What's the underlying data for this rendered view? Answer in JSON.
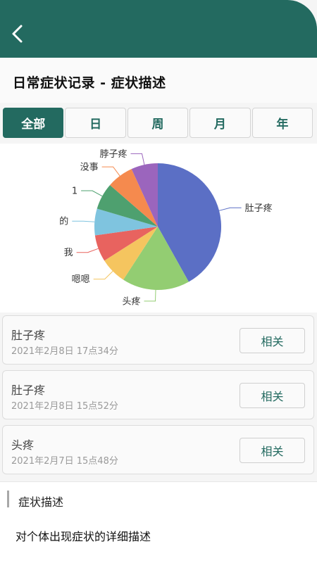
{
  "header": {
    "back_icon": "chevron-left-icon",
    "title": "日常症状记录 - 症状描述",
    "bar_color": "#236a60"
  },
  "tabs": [
    {
      "label": "全部",
      "active": true
    },
    {
      "label": "日",
      "active": false
    },
    {
      "label": "周",
      "active": false
    },
    {
      "label": "月",
      "active": false
    },
    {
      "label": "年",
      "active": false
    }
  ],
  "chart_data": {
    "type": "pie",
    "slices": [
      {
        "label": "肚子疼",
        "value": 8,
        "color": "#5b6fc5"
      },
      {
        "label": "头疼",
        "value": 3.3,
        "color": "#93cd72"
      },
      {
        "label": "嗯嗯",
        "value": 1.3,
        "color": "#f5c55f"
      },
      {
        "label": "我",
        "value": 1.3,
        "color": "#e8635f"
      },
      {
        "label": "的",
        "value": 1.3,
        "color": "#7fc4df"
      },
      {
        "label": "1",
        "value": 1.3,
        "color": "#4ea06f"
      },
      {
        "label": "没事",
        "value": 1.3,
        "color": "#f58a4e"
      },
      {
        "label": "脖子疼",
        "value": 1.3,
        "color": "#9b65bd"
      }
    ]
  },
  "records": [
    {
      "name": "肚子疼",
      "time": "2021年2月8日 17点34分",
      "button": "相关"
    },
    {
      "name": "肚子疼",
      "time": "2021年2月8日 15点52分",
      "button": "相关"
    },
    {
      "name": "头疼",
      "time": "2021年2月7日 15点48分",
      "button": "相关"
    }
  ],
  "description": {
    "title": "症状描述",
    "text": "对个体出现症状的详细描述"
  }
}
